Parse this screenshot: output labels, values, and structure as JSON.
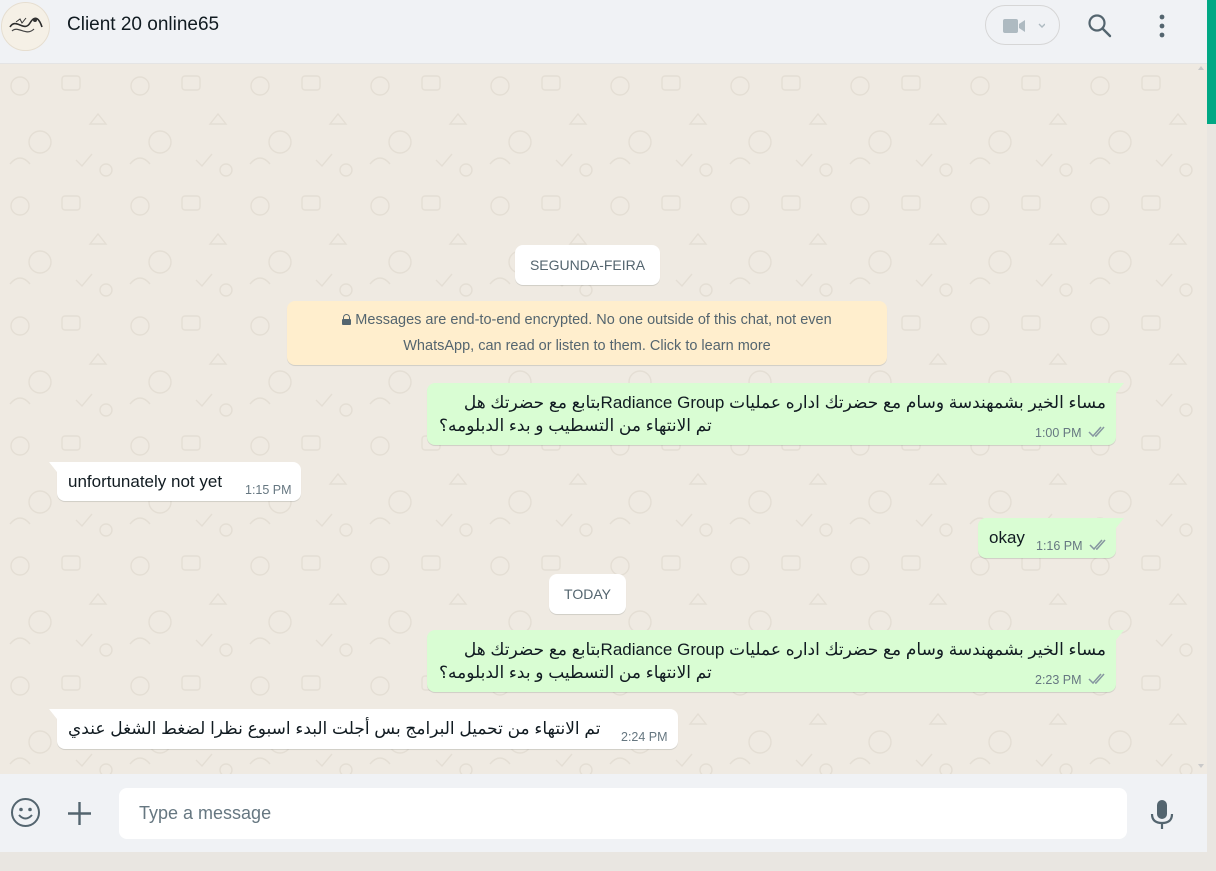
{
  "header": {
    "chat_name": "Client 20 online65",
    "icons": [
      "video-call-icon",
      "chevron-down-icon",
      "search-icon",
      "menu-icon"
    ]
  },
  "chat": {
    "date_chips": [
      "SEGUNDA-FEIRA",
      "TODAY"
    ],
    "encryption_notice": {
      "line1": "Messages are end-to-end encrypted. No one outside of this chat, not even",
      "line2": "WhatsApp, can read or listen to them. Click to learn more"
    },
    "messages": [
      {
        "direction": "outgoing",
        "lines": [
          "مساء الخير بشمهندسة وسام  مع  حضرتك اداره عمليات Radiance Groupبتابع مع حضرتك هل",
          "تم الانتهاء من التسطيب و بدء الدبلومه؟"
        ],
        "time": "1:00 PM",
        "status": "read"
      },
      {
        "direction": "incoming",
        "text": "unfortunately not yet",
        "time": "1:15 PM"
      },
      {
        "direction": "outgoing",
        "text": "okay",
        "time": "1:16 PM",
        "status": "read"
      },
      {
        "direction": "outgoing",
        "lines": [
          "مساء الخير بشمهندسة وسام  مع  حضرتك اداره عمليات Radiance Groupبتابع مع حضرتك هل",
          "تم الانتهاء من التسطيب و بدء الدبلومه؟"
        ],
        "time": "2:23 PM",
        "status": "read"
      },
      {
        "direction": "incoming",
        "text": "تم الانتهاء من تحميل البرامج بس أجلت البدء اسبوع نظرا لضغط الشغل عندي",
        "time": "2:24 PM"
      }
    ]
  },
  "footer": {
    "placeholder": "Type a message",
    "icons": [
      "emoji-icon",
      "plus-icon",
      "mic-icon"
    ]
  },
  "colors": {
    "accent": "#00a884",
    "outgoing_bubble": "#d9fdd3",
    "incoming_bubble": "#ffffff",
    "chat_background": "#efeae2",
    "encryption_bg": "#ffeecd",
    "read_ticks": "#8696a0"
  }
}
